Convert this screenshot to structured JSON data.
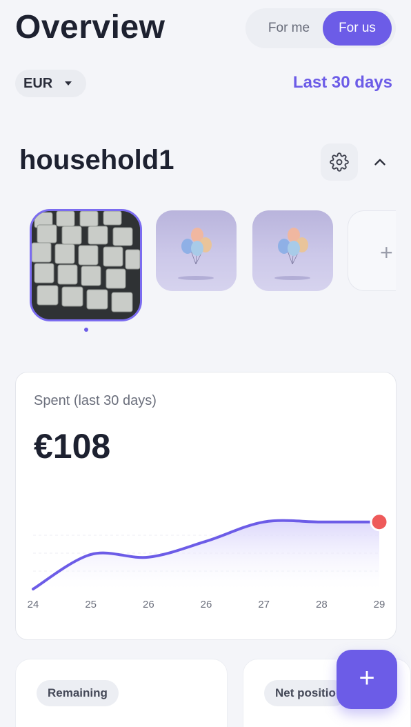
{
  "header": {
    "title": "Overview",
    "toggle": {
      "options": [
        "For me",
        "For us"
      ],
      "selected": "For us"
    }
  },
  "filters": {
    "currency": "EUR",
    "period": "Last 30 days"
  },
  "household": {
    "name": "household1",
    "icons": {
      "settings": "gear-icon",
      "collapse": "chevron-up-icon"
    },
    "items": [
      {
        "kind": "photo",
        "subject": "keyboard"
      },
      {
        "kind": "photo",
        "subject": "balloons"
      },
      {
        "kind": "photo",
        "subject": "balloons"
      },
      {
        "kind": "add",
        "label": "+"
      }
    ],
    "selected_index": 0
  },
  "spent_card": {
    "label": "Spent (last 30 days)",
    "amount": "€108"
  },
  "chart_data": {
    "type": "area",
    "categories": [
      "24",
      "25",
      "26",
      "26",
      "27",
      "28",
      "29"
    ],
    "values": [
      0,
      52,
      48,
      72,
      101,
      101,
      101
    ],
    "ylim": [
      0,
      108
    ],
    "grid": true,
    "colors": {
      "line": "#6c5ce7",
      "fill_top": "#d8d3fb",
      "end_marker": "#ee5a5a"
    }
  },
  "summary": {
    "remaining_label": "Remaining",
    "net_position_label": "Net positio"
  },
  "fab": {
    "label": "+"
  },
  "colors": {
    "accent": "#6c5ce7",
    "background": "#f4f5f9"
  }
}
